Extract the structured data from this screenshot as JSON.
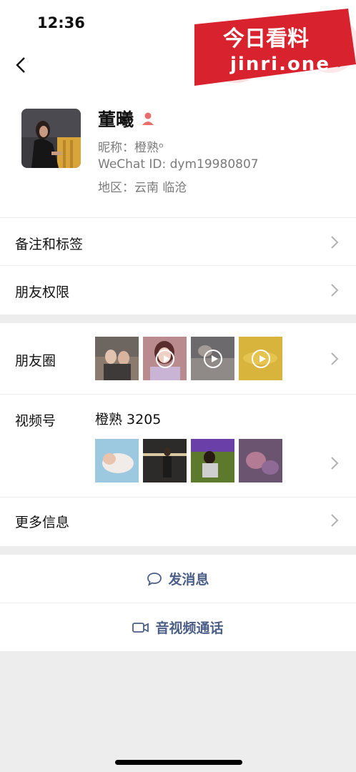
{
  "status_bar": {
    "time": "12:36"
  },
  "watermark": {
    "line1": "今日看料",
    "line2": "jinri.one"
  },
  "profile": {
    "name": "董曦",
    "nickname": "昵称：橙熟ᵒ",
    "wechat_id": "WeChat ID: dym19980807",
    "region": "地区：云南 临沧"
  },
  "rows": {
    "remarks": "备注和标签",
    "permissions": "朋友权限",
    "moments": "朋友圈",
    "channels": "视频号",
    "channels_name": "橙熟 3205",
    "more_info": "更多信息"
  },
  "actions": {
    "message": "发消息",
    "call": "音视频通话"
  },
  "colors": {
    "accent_link": "#4b5f86",
    "watermark_red": "#d8232f",
    "gender_icon": "#e86d6d"
  },
  "icons": {
    "back": "chevron-left-icon",
    "more": "more-dots-icon",
    "gender": "female-person-icon",
    "message": "chat-bubble-icon",
    "call": "video-camera-icon",
    "chevron": "chevron-right-icon"
  }
}
